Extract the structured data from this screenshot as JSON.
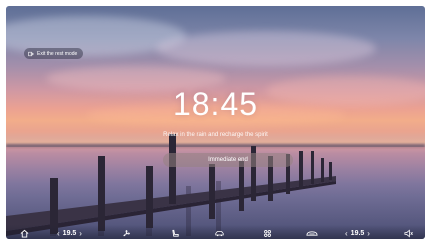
{
  "rest_mode": {
    "exit_label": "Exit the rest mode",
    "time": "18:45",
    "subtitle": "Relax in the rain and recharge the spirit",
    "end_button_label": "Immediate end"
  },
  "dock": {
    "left_temp": "19.5",
    "right_temp": "19.5",
    "decrease_arrow": "‹",
    "increase_arrow": "›",
    "icons": [
      "home-icon",
      "fan-icon",
      "seat-icon",
      "car-icon",
      "apps-icon",
      "climate-icon",
      "volume-icon"
    ]
  }
}
